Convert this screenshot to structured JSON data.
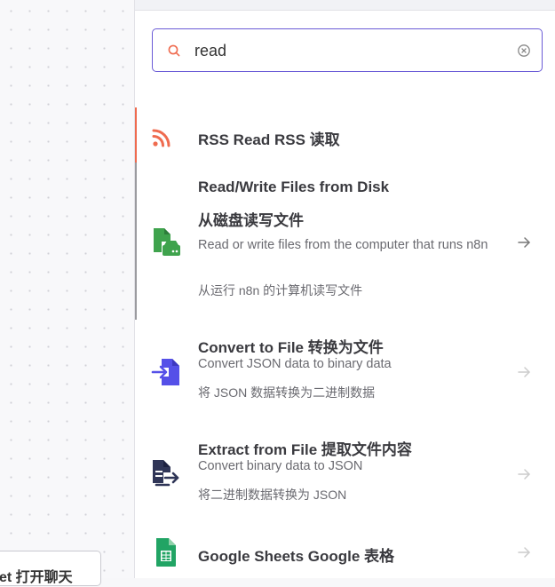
{
  "canvas": {
    "node_label": "et 打开聊天"
  },
  "search": {
    "value": "read",
    "placeholder": ""
  },
  "results": [
    {
      "title": "RSS Read  RSS 读取",
      "icon": "rss-icon",
      "color": "#ef6b4f"
    },
    {
      "title": "Read/Write Files from Disk",
      "title_cn": "从磁盘读写文件",
      "description": "Read or write files from the computer that runs n8n",
      "description_cn": "从运行 n8n 的计算机读写文件",
      "icon": "disk-file-icon",
      "color": "#3fa34d"
    },
    {
      "title": "Convert to File  转换为文件",
      "description": "Convert JSON data to binary data",
      "description_cn": "将 JSON 数据转换为二进制数据",
      "icon": "convert-file-icon",
      "color": "#5550e8"
    },
    {
      "title": "Extract from File  提取文件内容",
      "description": "Convert binary data to JSON",
      "description_cn": "将二进制数据转换为 JSON",
      "icon": "extract-file-icon",
      "color": "#2f3557"
    },
    {
      "title": "Google Sheets  Google 表格",
      "icon": "google-sheets-icon",
      "color": "#21a464"
    }
  ]
}
